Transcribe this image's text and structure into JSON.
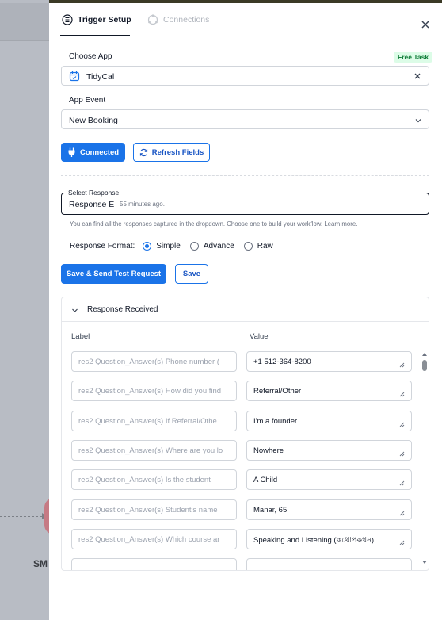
{
  "background": {
    "node_label": "SM"
  },
  "tabs": {
    "active_label": "Trigger Setup",
    "inactive_label": "Connections"
  },
  "choose_app": {
    "label": "Choose App",
    "badge": "Free Task",
    "value": "TidyCal"
  },
  "app_event": {
    "label": "App Event",
    "value": "New Booking"
  },
  "actions": {
    "connected_label": "Connected",
    "refresh_label": "Refresh Fields"
  },
  "select_response": {
    "legend": "Select Response",
    "value": "Response E",
    "time": "55 minutes ago.",
    "help": "You can find all the responses captured in the dropdown. Choose one to build your workflow. Learn more."
  },
  "response_format": {
    "label": "Response Format:",
    "options": [
      "Simple",
      "Advance",
      "Raw"
    ],
    "selected": "Simple"
  },
  "buttons": {
    "save_send": "Save & Send Test Request",
    "save": "Save"
  },
  "response_received": {
    "title": "Response Received",
    "col_label": "Label",
    "col_value": "Value",
    "rows": [
      {
        "key": "res2 Question_Answer(s) Phone number (",
        "value": "+1 512-364-8200"
      },
      {
        "key": "res2 Question_Answer(s) How did you find",
        "value": "Referral/Other"
      },
      {
        "key": "res2 Question_Answer(s) If Referral/Othe",
        "value": "I'm a founder"
      },
      {
        "key": "res2 Question_Answer(s) Where are you lo",
        "value": "Nowhere"
      },
      {
        "key": "res2 Question_Answer(s) Is the student",
        "value": "A Child"
      },
      {
        "key": "res2 Question_Answer(s) Student's name",
        "value": "Manar, 65"
      },
      {
        "key": "res2 Question_Answer(s) Which course ar",
        "value": "Speaking and Listening (কথোপকথন)"
      },
      {
        "key": "",
        "value": ""
      }
    ]
  },
  "colors": {
    "accent": "#1a73e8",
    "badge_green": "#15803d"
  }
}
